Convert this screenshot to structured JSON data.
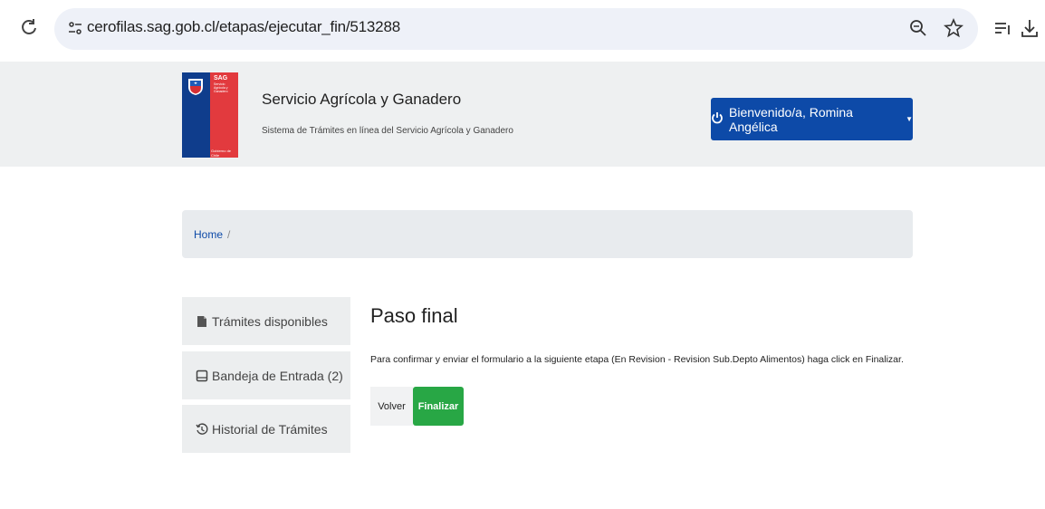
{
  "browser": {
    "url": "cerofilas.sag.gob.cl/etapas/ejecutar_fin/513288",
    "icons": [
      "reload-icon",
      "site-info-icon",
      "zoom-icon",
      "bookmark-star-icon",
      "reading-list-icon",
      "download-icon"
    ]
  },
  "header": {
    "logo": {
      "brand": "SAG",
      "sub": "Servicio Agrícola y Ganadero",
      "gov": "Gobierno de Chile"
    },
    "title": "Servicio Agrícola y Ganadero",
    "subtitle": "Sistema de Trámites en línea del Servicio Agrícola y Ganadero",
    "user_button": "Bienvenido/a, Romina Angélica"
  },
  "breadcrumb": {
    "home": "Home",
    "separator": "/"
  },
  "sidebar": {
    "items": [
      {
        "label": "Trámites disponibles",
        "icon": "file-icon"
      },
      {
        "label": "Bandeja de Entrada (2)",
        "icon": "inbox-icon"
      },
      {
        "label": "Historial de Trámites",
        "icon": "history-icon"
      }
    ]
  },
  "main": {
    "title": "Paso final",
    "text": "Para confirmar y enviar el formulario a la siguiente etapa (En Revision - Revision Sub.Depto Alimentos) haga click en Finalizar.",
    "back_label": "Volver",
    "finish_label": "Finalizar"
  },
  "colors": {
    "primary": "#0d4aa8",
    "success": "#28a745",
    "header_bg": "#eef0f1"
  }
}
